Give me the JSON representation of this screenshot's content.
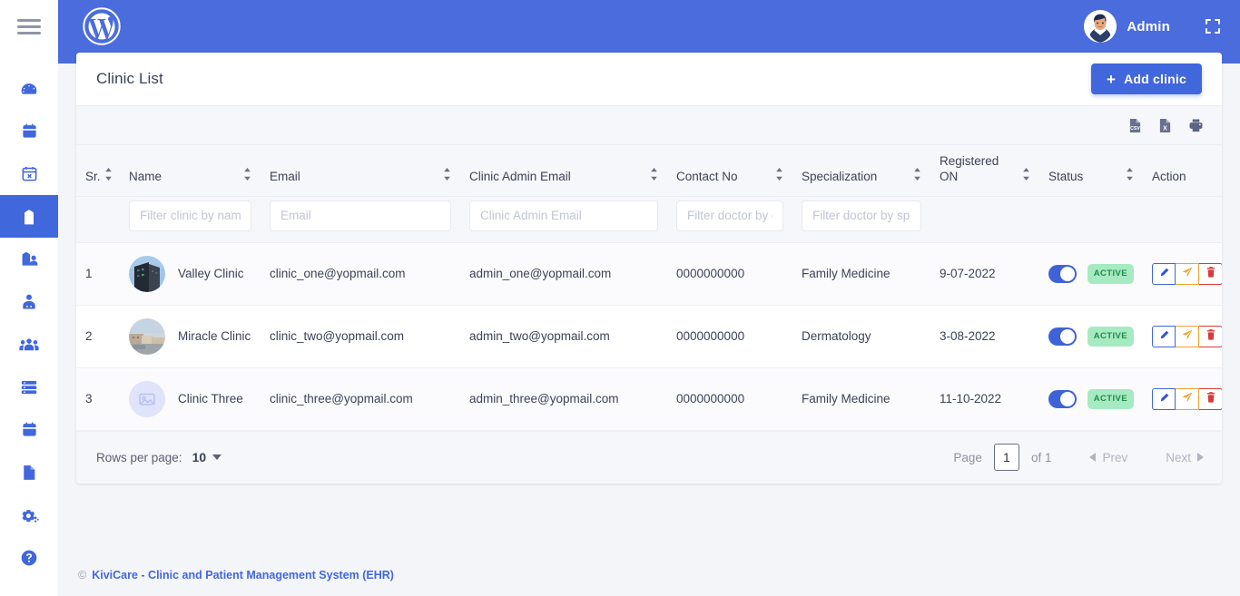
{
  "sidebar": {
    "menu_icon": "hamburger-menu-icon",
    "items": [
      {
        "icon": "dashboard-icon",
        "name": "dashboard",
        "active": false
      },
      {
        "icon": "calendar-icon",
        "name": "appointments",
        "active": false
      },
      {
        "icon": "calendar-cancel-icon",
        "name": "cancelled-appointments",
        "active": false
      },
      {
        "icon": "clinic-building-icon",
        "name": "clinic",
        "active": true
      },
      {
        "icon": "clinic-admin-icon",
        "name": "clinic-admin",
        "active": false
      },
      {
        "icon": "doctor-icon",
        "name": "doctor",
        "active": false
      },
      {
        "icon": "patients-icon",
        "name": "patients",
        "active": false
      },
      {
        "icon": "services-list-icon",
        "name": "services",
        "active": false
      },
      {
        "icon": "calendar-holiday-icon",
        "name": "holidays",
        "active": false
      },
      {
        "icon": "document-icon",
        "name": "reports",
        "active": false
      },
      {
        "icon": "settings-gears-icon",
        "name": "settings",
        "active": false
      },
      {
        "icon": "help-circle-icon",
        "name": "help",
        "active": false
      }
    ]
  },
  "topbar": {
    "logo": "wordpress-logo",
    "user_name": "Admin",
    "avatar": "user-avatar",
    "fullscreen_icon": "fullscreen-icon"
  },
  "card": {
    "title": "Clinic List",
    "add_button": {
      "label": "Add clinic",
      "plus": "+"
    }
  },
  "toolbar": {
    "exports": [
      {
        "name": "export-csv-icon",
        "label": "CSV"
      },
      {
        "name": "export-excel-icon",
        "label": "X"
      },
      {
        "name": "print-icon",
        "label": "Print"
      }
    ]
  },
  "table": {
    "columns": [
      {
        "label": "Sr.",
        "sortable": true
      },
      {
        "label": "Name",
        "sortable": true
      },
      {
        "label": "Email",
        "sortable": true
      },
      {
        "label": "Clinic Admin Email",
        "sortable": true
      },
      {
        "label": "Contact No",
        "sortable": true
      },
      {
        "label": "Specialization",
        "sortable": true
      },
      {
        "label": "Registered ON",
        "sortable": true
      },
      {
        "label": "Status",
        "sortable": true
      },
      {
        "label": "Action",
        "sortable": true
      }
    ],
    "filters": [
      {
        "placeholder": "",
        "visible": false
      },
      {
        "placeholder": "Filter clinic by name",
        "visible": true
      },
      {
        "placeholder": "Email",
        "visible": true
      },
      {
        "placeholder": "Clinic Admin Email",
        "visible": true
      },
      {
        "placeholder": "Filter doctor by contact no",
        "visible": true
      },
      {
        "placeholder": "Filter doctor by specialization",
        "visible": true
      },
      {
        "placeholder": "",
        "visible": false
      },
      {
        "placeholder": "",
        "visible": false
      },
      {
        "placeholder": "",
        "visible": false
      }
    ],
    "rows": [
      {
        "sr": "1",
        "name": "Valley Clinic",
        "email": "clinic_one@yopmail.com",
        "admin_email": "admin_one@yopmail.com",
        "contact": "0000000000",
        "specialization": "Family Medicine",
        "registered_on": "9-07-2022",
        "status_on": true,
        "status_badge": "ACTIVE",
        "photo": "building-photo"
      },
      {
        "sr": "2",
        "name": "Miracle Clinic",
        "email": "clinic_two@yopmail.com",
        "admin_email": "admin_two@yopmail.com",
        "contact": "0000000000",
        "specialization": "Dermatology",
        "registered_on": "3-08-2022",
        "status_on": true,
        "status_badge": "ACTIVE",
        "photo": "landscape-photo"
      },
      {
        "sr": "3",
        "name": "Clinic Three",
        "email": "clinic_three@yopmail.com",
        "admin_email": "admin_three@yopmail.com",
        "contact": "0000000000",
        "specialization": "Family Medicine",
        "registered_on": "11-10-2022",
        "status_on": true,
        "status_badge": "ACTIVE",
        "photo": "placeholder-image"
      }
    ],
    "actions": [
      {
        "name": "edit-button",
        "icon": "pencil-icon",
        "color": "#2f55d4"
      },
      {
        "name": "send-button",
        "icon": "paper-plane-icon",
        "color": "#f0a132"
      },
      {
        "name": "delete-button",
        "icon": "trash-icon",
        "color": "#d93a3a"
      }
    ]
  },
  "table_footer": {
    "rows_per_page_label": "Rows per page:",
    "rows_per_page_value": "10",
    "page_label": "Page",
    "page_value": "1",
    "of_label": "of 1",
    "prev_label": "Prev",
    "next_label": "Next"
  },
  "page_footer": {
    "copyright": "©",
    "link_text": "KiviCare - Clinic and Patient Management System (EHR)"
  },
  "colors": {
    "brand_blue": "#4a6cdd",
    "accent_blue": "#4167dd",
    "toggle_on": "#3f63d6",
    "badge_bg": "#a6eac2",
    "badge_text": "#1f8a4c",
    "edit": "#2f55d4",
    "send": "#f0a132",
    "delete": "#d93a3a",
    "page_bg": "#f4f5f9"
  }
}
